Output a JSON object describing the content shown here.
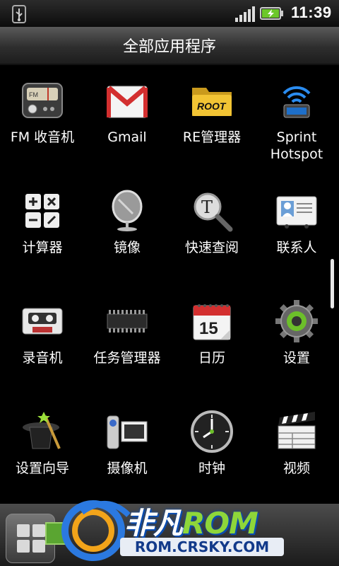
{
  "status_bar": {
    "time": "11:39",
    "icons": [
      "usb-icon",
      "signal-icon",
      "battery-charging-icon"
    ]
  },
  "title": "全部应用程序",
  "apps": [
    {
      "label": "FM 收音机",
      "icon": "radio-icon"
    },
    {
      "label": "Gmail",
      "icon": "gmail-icon"
    },
    {
      "label": "RE管理器",
      "icon": "folder-root-icon",
      "icon_text": "ROOT"
    },
    {
      "label": "Sprint Hotspot",
      "icon": "hotspot-icon"
    },
    {
      "label": "计算器",
      "icon": "calculator-icon"
    },
    {
      "label": "镜像",
      "icon": "mirror-icon"
    },
    {
      "label": "快速查阅",
      "icon": "quick-lookup-icon"
    },
    {
      "label": "联系人",
      "icon": "contacts-icon"
    },
    {
      "label": "录音机",
      "icon": "cassette-icon"
    },
    {
      "label": "任务管理器",
      "icon": "chip-icon"
    },
    {
      "label": "日历",
      "icon": "calendar-icon",
      "icon_text": "15"
    },
    {
      "label": "设置",
      "icon": "gear-icon"
    },
    {
      "label": "设置向导",
      "icon": "magic-hat-icon"
    },
    {
      "label": "摄像机",
      "icon": "camcorder-icon"
    },
    {
      "label": "时钟",
      "icon": "clock-icon"
    },
    {
      "label": "视频",
      "icon": "clapperboard-icon"
    }
  ],
  "watermark": {
    "brand_cn": "非凡",
    "brand_rom": "ROM",
    "url": "ROM.CRSKY.COM"
  },
  "colors": {
    "accent_green": "#5aa531",
    "watermark_blue": "#0a4cb0"
  }
}
